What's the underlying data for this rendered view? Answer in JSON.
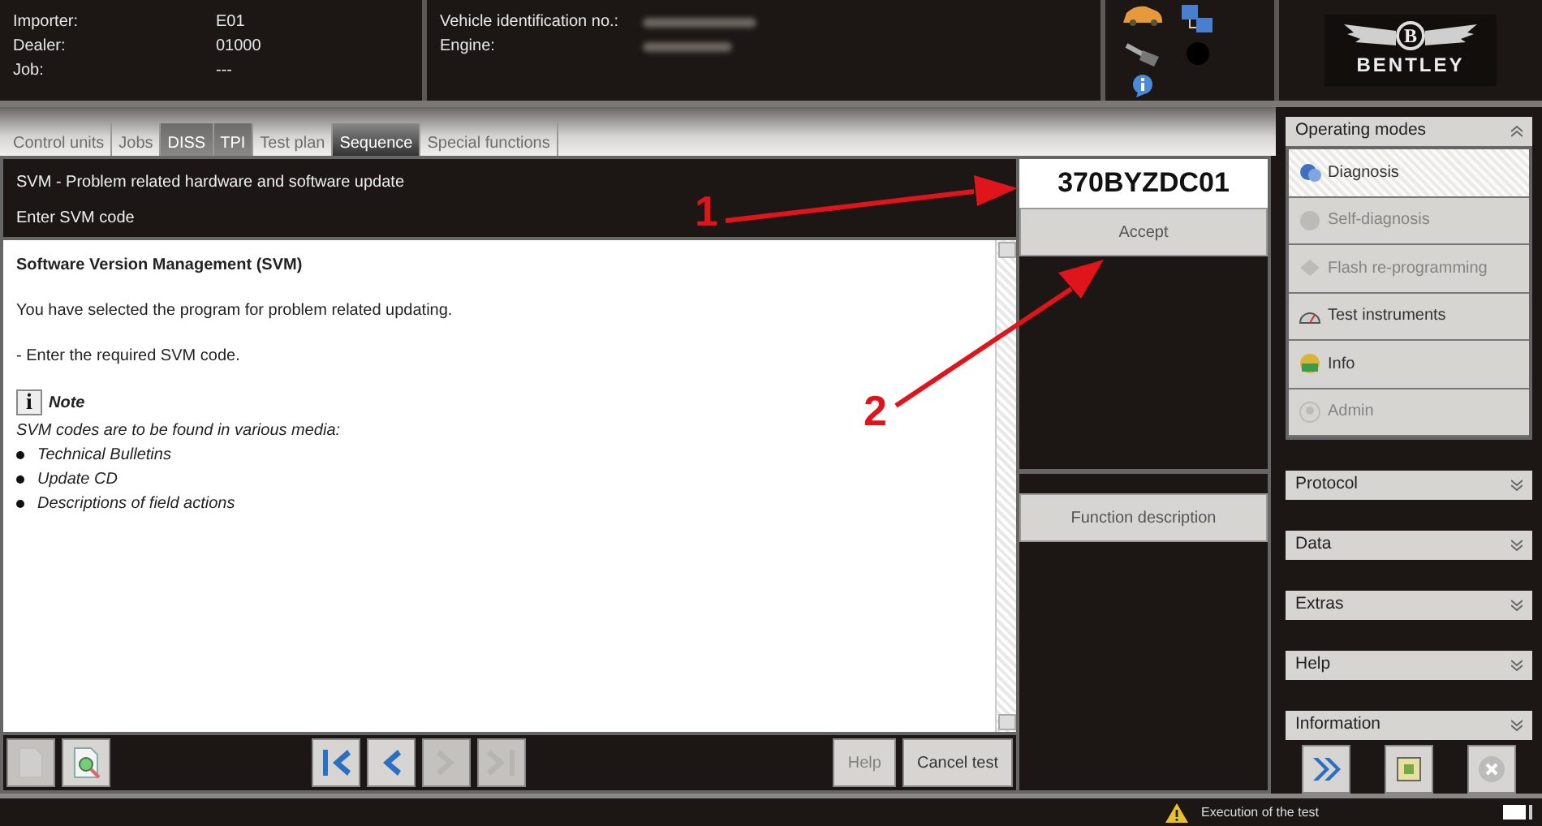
{
  "header": {
    "fields": [
      {
        "label": "Importer:",
        "value": "E01"
      },
      {
        "label": "Dealer:",
        "value": "01000"
      },
      {
        "label": "Job:",
        "value": "---"
      }
    ],
    "vehicle_fields": [
      {
        "label": "Vehicle identification no.:"
      },
      {
        "label": "Engine:"
      }
    ],
    "status_icons": [
      {
        "kind": "car"
      },
      {
        "kind": "network"
      },
      {
        "kind": "key"
      },
      {
        "kind": "dot"
      },
      {
        "kind": "info"
      }
    ],
    "logo": {
      "monogram": "B",
      "name": "BENTLEY"
    }
  },
  "tabs": [
    {
      "label": "Control units",
      "selected": false,
      "disabled": true
    },
    {
      "label": "Jobs",
      "selected": false,
      "disabled": true
    },
    {
      "label": "DISS",
      "selected": false,
      "disabled": false
    },
    {
      "label": "TPI",
      "selected": false,
      "disabled": false
    },
    {
      "label": "Test plan",
      "selected": false,
      "disabled": true
    },
    {
      "label": "Sequence",
      "selected": true,
      "disabled": false
    },
    {
      "label": "Special functions",
      "selected": false,
      "disabled": true
    }
  ],
  "program": {
    "title": "SVM - Problem related hardware and software update",
    "step": "Enter SVM code"
  },
  "content": {
    "heading": "Software Version Management (SVM)",
    "paragraphs": [
      "You have selected the program for problem related updating.",
      "- Enter the required SVM code."
    ],
    "note": {
      "icon": "i",
      "title": "Note",
      "text": "SVM codes are to be found in various media:",
      "items": [
        "Technical Bulletins",
        "Update CD",
        "Descriptions of field actions"
      ]
    }
  },
  "code_field": {
    "value": "370BYZDC01"
  },
  "accept_button": {
    "label": "Accept"
  },
  "function_description_button": {
    "label": "Function description"
  },
  "toolbar": {
    "buttons": [
      {
        "kind": "document",
        "disabled": true
      },
      {
        "kind": "document-search",
        "disabled": false
      },
      {
        "kind": "first",
        "disabled": false
      },
      {
        "kind": "previous",
        "disabled": false
      },
      {
        "kind": "next",
        "disabled": true
      },
      {
        "kind": "last",
        "disabled": true
      }
    ],
    "help": {
      "label": "Help",
      "disabled": true
    },
    "cancel": {
      "label": "Cancel test",
      "disabled": false
    }
  },
  "sidebar": {
    "operating_modes": {
      "title": "Operating modes",
      "expanded": true,
      "items": [
        {
          "label": "Diagnosis",
          "kind": "diagnosis",
          "selected": true,
          "disabled": false
        },
        {
          "label": "Self-diagnosis",
          "kind": "self",
          "selected": false,
          "disabled": true
        },
        {
          "label": "Flash re-programming",
          "kind": "flash",
          "selected": false,
          "disabled": true
        },
        {
          "label": "Test instruments",
          "kind": "gauge",
          "selected": false,
          "disabled": false
        },
        {
          "label": "Info",
          "kind": "info",
          "selected": false,
          "disabled": false
        },
        {
          "label": "Admin",
          "kind": "admin",
          "selected": false,
          "disabled": true
        }
      ]
    },
    "sections": [
      {
        "title": "Protocol",
        "expanded": false
      },
      {
        "title": "Data",
        "expanded": false
      },
      {
        "title": "Extras",
        "expanded": false
      },
      {
        "title": "Help",
        "expanded": false
      },
      {
        "title": "Information",
        "expanded": false
      }
    ],
    "buttons": [
      {
        "kind": "forward",
        "disabled": false
      },
      {
        "kind": "frame",
        "disabled": false
      },
      {
        "kind": "close",
        "disabled": true
      }
    ]
  },
  "status_bar": {
    "message": "Execution of the test"
  },
  "annotations": [
    {
      "label": "1"
    },
    {
      "label": "2"
    }
  ]
}
